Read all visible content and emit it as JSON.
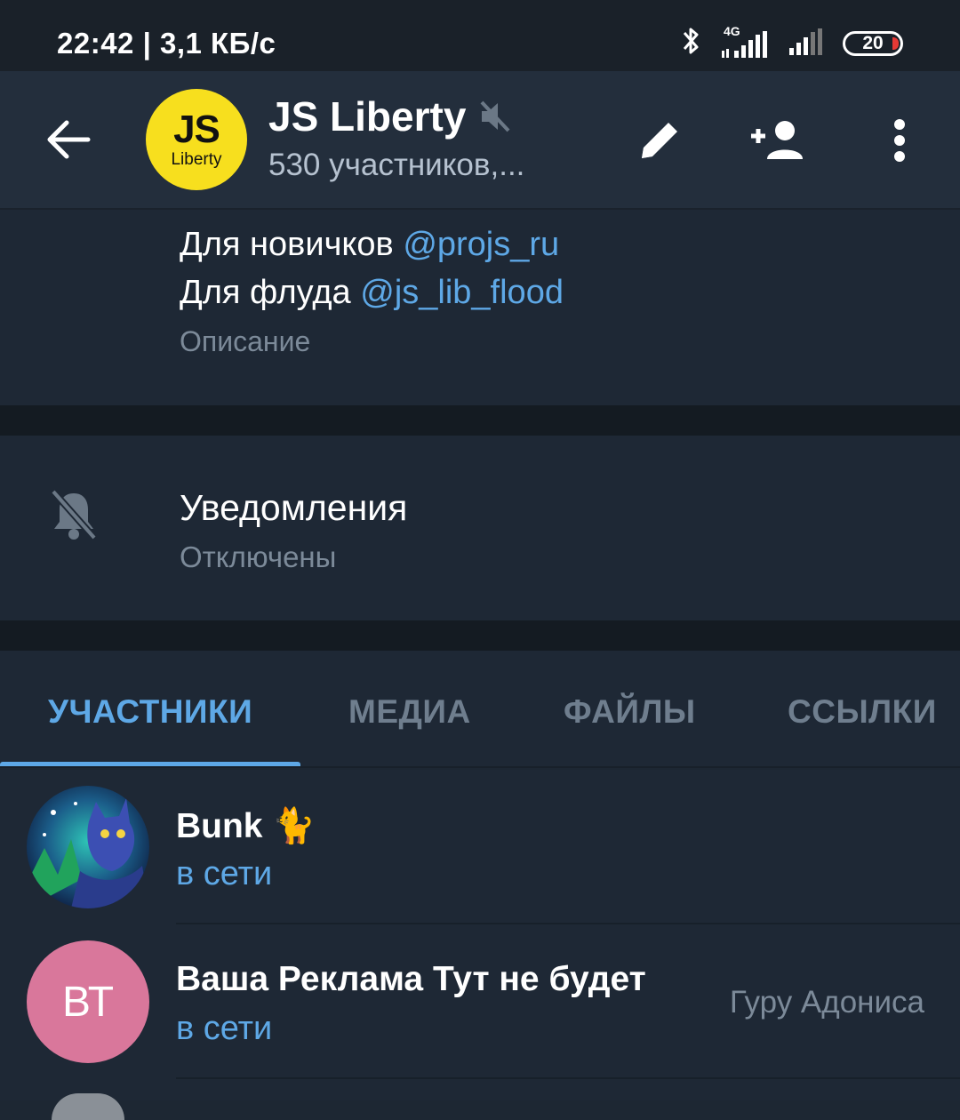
{
  "status_bar": {
    "time_speed": "22:42 | 3,1 КБ/с",
    "network": "4G",
    "battery": "20"
  },
  "header": {
    "avatar_initials": "JS",
    "avatar_sub": "Liberty",
    "title": "JS Liberty",
    "subtitle": "530 участников,..."
  },
  "description": {
    "line1_prefix": "Для новичков ",
    "line1_link": "@projs_ru",
    "line2_prefix": "Для флуда ",
    "line2_link": "@js_lib_flood",
    "label": "Описание"
  },
  "notifications": {
    "title": "Уведомления",
    "value": "Отключены"
  },
  "tabs": [
    {
      "label": "УЧАСТНИКИ"
    },
    {
      "label": "МЕДИА"
    },
    {
      "label": "ФАЙЛЫ"
    },
    {
      "label": "ССЫЛКИ"
    }
  ],
  "members": [
    {
      "name": "Bunk 🐈",
      "status": "в сети",
      "role": ""
    },
    {
      "name": "Ваша Реклама Тут не будет",
      "status": "в сети",
      "role": "Гуру Адониса",
      "initials": "ВТ"
    }
  ],
  "colors": {
    "accent": "#5ea8e6",
    "background": "#1e2835",
    "header": "#232e3c",
    "js_yellow": "#f7df1e",
    "avatar_pink": "#d9779b"
  }
}
